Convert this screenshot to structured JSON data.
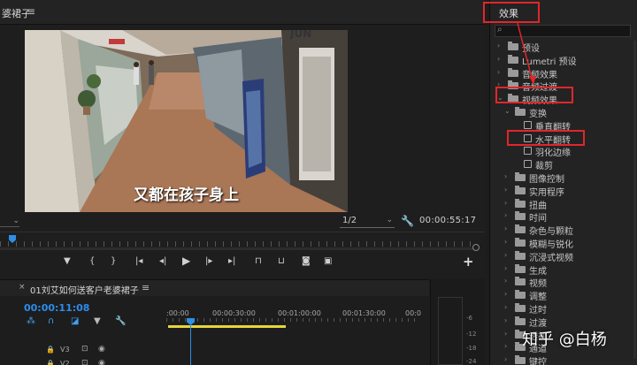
{
  "monitor": {
    "title": "婆裙子",
    "menu_icon": "≡",
    "subtitle": "又都在孩子身上",
    "resolution": "1/2",
    "timecode": "00:00:55:17"
  },
  "timeline": {
    "close_icon": "×",
    "sequence_title": "01刘艾如何送客户老婆裙子",
    "menu_icon": "≡",
    "timecode": "00:00:11:08",
    "ruler_labels": [
      ":00:00",
      "00:00:30:00",
      "00:01:00:00",
      "00:01:30:00",
      "00:0"
    ],
    "tracks": [
      {
        "name": "V3"
      },
      {
        "name": "V2"
      }
    ]
  },
  "meter": {
    "labels": [
      "-6",
      "-12",
      "-18",
      "-24"
    ]
  },
  "effects": {
    "tab": "效果",
    "search_placeholder": "",
    "items": [
      {
        "label": "预设",
        "level": 0,
        "kind": "folder"
      },
      {
        "label": "Lumetri 预设",
        "level": 0,
        "kind": "folder"
      },
      {
        "label": "音频效果",
        "level": 0,
        "kind": "folder"
      },
      {
        "label": "音频过渡",
        "level": 0,
        "kind": "folder"
      },
      {
        "label": "视频效果",
        "level": 0,
        "kind": "folder",
        "open": true
      },
      {
        "label": "变换",
        "level": 1,
        "kind": "folder",
        "open": true
      },
      {
        "label": "垂直翻转",
        "level": 2,
        "kind": "effect"
      },
      {
        "label": "水平翻转",
        "level": 2,
        "kind": "effect"
      },
      {
        "label": "羽化边缘",
        "level": 2,
        "kind": "effect"
      },
      {
        "label": "裁剪",
        "level": 2,
        "kind": "effect"
      },
      {
        "label": "图像控制",
        "level": 1,
        "kind": "folder"
      },
      {
        "label": "实用程序",
        "level": 1,
        "kind": "folder"
      },
      {
        "label": "扭曲",
        "level": 1,
        "kind": "folder"
      },
      {
        "label": "时间",
        "level": 1,
        "kind": "folder"
      },
      {
        "label": "杂色与颗粒",
        "level": 1,
        "kind": "folder"
      },
      {
        "label": "模糊与锐化",
        "level": 1,
        "kind": "folder"
      },
      {
        "label": "沉浸式视频",
        "level": 1,
        "kind": "folder"
      },
      {
        "label": "生成",
        "level": 1,
        "kind": "folder"
      },
      {
        "label": "视频",
        "level": 1,
        "kind": "folder"
      },
      {
        "label": "调整",
        "level": 1,
        "kind": "folder"
      },
      {
        "label": "过时",
        "level": 1,
        "kind": "folder"
      },
      {
        "label": "过渡",
        "level": 1,
        "kind": "folder"
      },
      {
        "label": "透视",
        "level": 1,
        "kind": "folder"
      },
      {
        "label": "通道",
        "level": 1,
        "kind": "folder"
      },
      {
        "label": "键控",
        "level": 1,
        "kind": "folder"
      }
    ]
  },
  "watermark": "知乎 @白杨",
  "colors": {
    "accent_blue": "#2d8ceb",
    "work_area_yellow": "#e6d53a",
    "annotation_red": "#e2262a"
  }
}
